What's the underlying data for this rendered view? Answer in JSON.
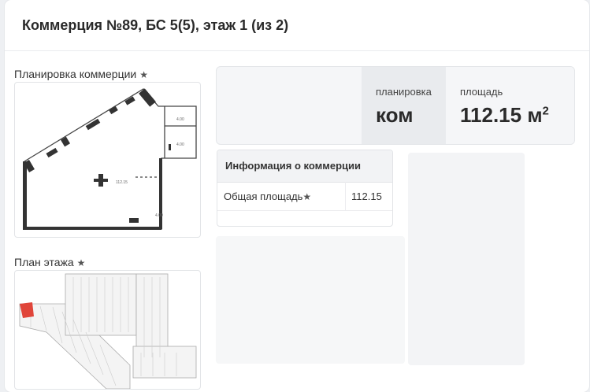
{
  "header": {
    "title": "Коммерция №89, БС 5(5), этаж 1 (из 2)"
  },
  "plan_section": {
    "label": "Планировка коммерции",
    "star": "★"
  },
  "floor_section": {
    "label": "План этажа",
    "star": "★"
  },
  "stats": {
    "layout_caption": "планировка",
    "layout_value": "ком",
    "area_caption": "площадь",
    "area_value": "112.15 м",
    "area_unit_sup": "2"
  },
  "info": {
    "title": "Информация о коммерции",
    "rows": [
      {
        "key": "Общая площадь",
        "star": "★",
        "value": "112.15"
      }
    ]
  },
  "colors": {
    "accent_red": "#e0453a",
    "wall": "#333333",
    "border": "#e2e4e7"
  }
}
